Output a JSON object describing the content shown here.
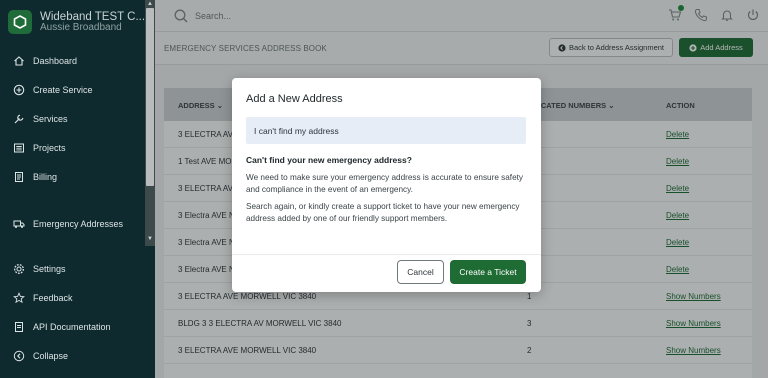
{
  "brand": {
    "title": "Wideband TEST C...",
    "subtitle": "Aussie Broadband"
  },
  "sidebar": {
    "items": [
      {
        "label": "Dashboard",
        "icon": "home-icon"
      },
      {
        "label": "Create Service",
        "icon": "plus-circle-icon"
      },
      {
        "label": "Services",
        "icon": "wrench-icon"
      },
      {
        "label": "Projects",
        "icon": "list-icon"
      },
      {
        "label": "Billing",
        "icon": "document-icon"
      },
      {
        "label": "Emergency Addresses",
        "icon": "truck-icon"
      },
      {
        "label": "Settings",
        "icon": "gear-icon"
      },
      {
        "label": "Feedback",
        "icon": "star-icon"
      },
      {
        "label": "API Documentation",
        "icon": "doc-icon"
      },
      {
        "label": "Collapse",
        "icon": "collapse-icon"
      }
    ]
  },
  "topbar": {
    "search_placeholder": "Search..."
  },
  "page": {
    "title": "EMERGENCY SERVICES ADDRESS BOOK",
    "back_button": "Back to Address Assignment",
    "add_button": "Add Address"
  },
  "table": {
    "columns": {
      "address": "ADDRESS",
      "allocated": "OCATED NUMBERS",
      "action": "ACTION"
    },
    "rows": [
      {
        "address": "3 ELECTRA AVE",
        "count": "",
        "action": "Delete"
      },
      {
        "address": "1 Test AVE MO",
        "count": "",
        "action": "Delete"
      },
      {
        "address": "3 ELECTRA AVE",
        "count": "",
        "action": "Delete"
      },
      {
        "address": "3 Electra AVE N",
        "count": "",
        "action": "Delete"
      },
      {
        "address": "3 Electra AVE N",
        "count": "",
        "action": "Delete"
      },
      {
        "address": "3 Electra AVE N",
        "count": "",
        "action": "Delete"
      },
      {
        "address": "3 ELECTRA AVE MORWELL VIC 3840",
        "count": "1",
        "action": "Show Numbers"
      },
      {
        "address": "BLDG 3 3 ELECTRA AV MORWELL VIC 3840",
        "count": "3",
        "action": "Show Numbers"
      },
      {
        "address": "3 ELECTRA AVE MORWELL VIC 3840",
        "count": "2",
        "action": "Show Numbers"
      }
    ]
  },
  "modal": {
    "title": "Add a New Address",
    "input_value": "I can't find my address",
    "heading": "Can't find your new emergency address?",
    "paragraph1": "We need to make sure your emergency address is accurate to ensure safety and compliance in the event of an emergency.",
    "paragraph2": "Search again, or kindly create a support ticket to have your new emergency address added by one of our friendly support members.",
    "cancel_label": "Cancel",
    "create_label": "Create a Ticket"
  },
  "colors": {
    "sidebar_bg": "#0e2a2f",
    "accent_green": "#1e6b34",
    "link_green": "#1d6a35"
  }
}
